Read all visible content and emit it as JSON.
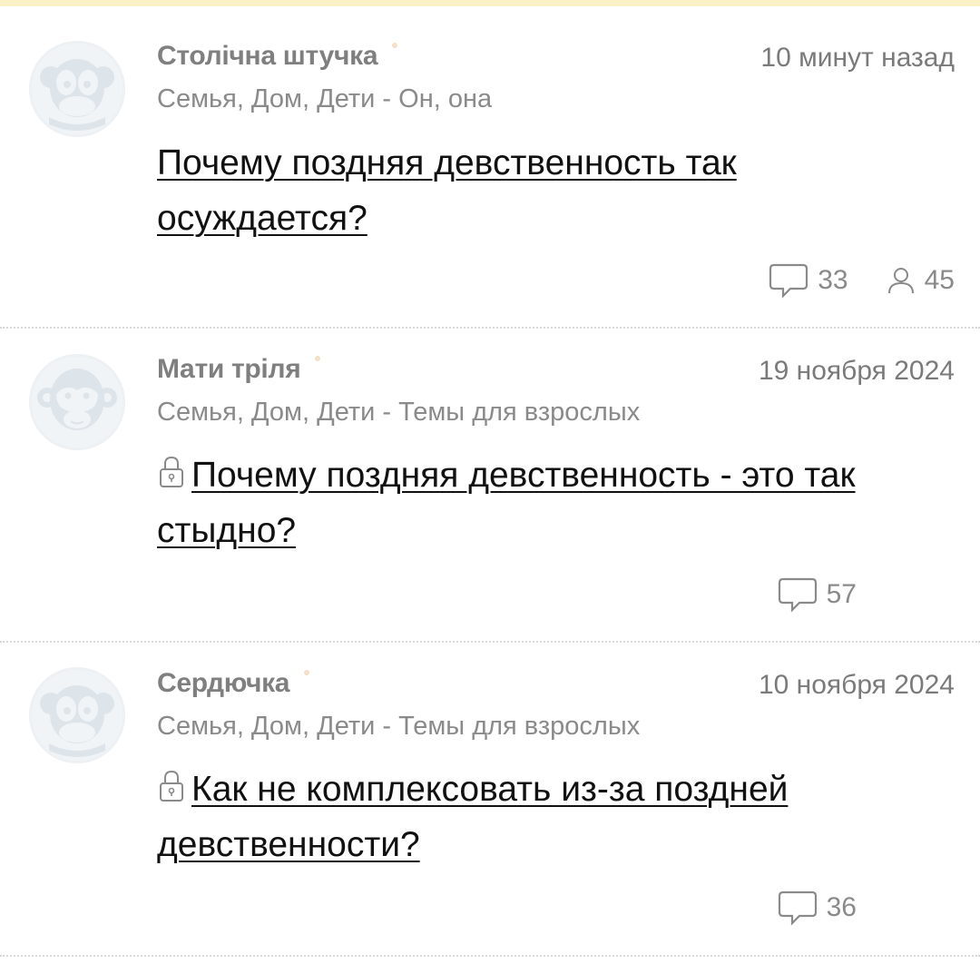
{
  "posts": [
    {
      "author": "Столічна штучка",
      "timestamp": "10 минут назад",
      "category": "Семья, Дом, Дети - Он, она",
      "title": "Почему поздняя девственность так осуждается?",
      "locked": false,
      "comments": "33",
      "participants": "45",
      "avatar_icon": "monkey-avatar-icon"
    },
    {
      "author": "Мати тріля",
      "timestamp": "19 ноября 2024",
      "category": "Семья, Дом, Дети - Темы для взрослых",
      "title": "Почему поздняя девственность - это так стыдно?",
      "locked": true,
      "comments": "57",
      "avatar_icon": "monkey-avatar-icon"
    },
    {
      "author": "Сердючка",
      "timestamp": "10 ноября 2024",
      "category": "Семья, Дом, Дети - Темы для взрослых",
      "title": "Как не комплексовать из-за поздней девственности?",
      "locked": true,
      "comments": "36",
      "avatar_icon": "monkey-avatar-icon"
    }
  ],
  "colors": {
    "top_strip": "#fbf1c6",
    "meta_text": "#7f7f7f",
    "title_text": "#111111",
    "online_dot": "#f5dfc5",
    "divider": "#d7d7d7"
  }
}
